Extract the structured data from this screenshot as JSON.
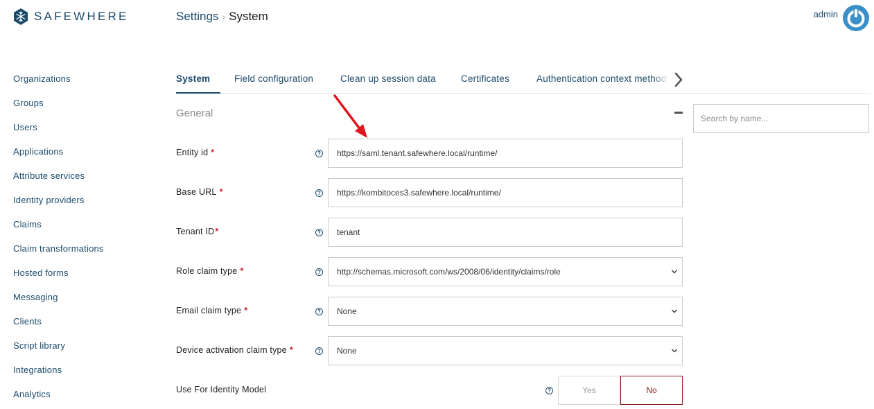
{
  "brand": {
    "name": "SAFEWHERE"
  },
  "header": {
    "breadcrumb_parent": "Settings",
    "breadcrumb_current": "System"
  },
  "user": {
    "name": "admin"
  },
  "sidebar": {
    "items": [
      {
        "label": "Organizations"
      },
      {
        "label": "Groups"
      },
      {
        "label": "Users"
      },
      {
        "label": "Applications"
      },
      {
        "label": "Attribute services"
      },
      {
        "label": "Identity providers"
      },
      {
        "label": "Claims"
      },
      {
        "label": "Claim transformations"
      },
      {
        "label": "Hosted forms"
      },
      {
        "label": "Messaging"
      },
      {
        "label": "Clients"
      },
      {
        "label": "Script library"
      },
      {
        "label": "Integrations"
      },
      {
        "label": "Analytics"
      }
    ]
  },
  "tabs": [
    {
      "label": "System",
      "active": true
    },
    {
      "label": "Field configuration"
    },
    {
      "label": "Clean up session data"
    },
    {
      "label": "Certificates"
    },
    {
      "label": "Authentication context methods"
    }
  ],
  "section": {
    "title": "General"
  },
  "search": {
    "placeholder": "Search by name..."
  },
  "form": {
    "entity_id": {
      "label": "Entity id",
      "value": "https://saml.tenant.safewhere.local/runtime/"
    },
    "base_url": {
      "label": "Base URL",
      "value": "https://kombitoces3.safewhere.local/runtime/"
    },
    "tenant_id": {
      "label": "Tenant ID",
      "value": "tenant"
    },
    "role_claim_type": {
      "label": "Role claim type",
      "value": "http://schemas.microsoft.com/ws/2008/06/identity/claims/role"
    },
    "email_claim_type": {
      "label": "Email claim type",
      "value": "None"
    },
    "device_activation_claim_type": {
      "label": "Device activation claim type",
      "value": "None"
    },
    "use_for_identity_model": {
      "label": "Use For Identity Model",
      "yes_label": "Yes",
      "no_label": "No",
      "selected": "No"
    }
  },
  "required_mark": "*",
  "help_mark": "?",
  "colors": {
    "primary": "#1b4a6b",
    "required": "#c0272d",
    "toggle_active": "#8b1a1a",
    "annotation_arrow": "#e0141e"
  },
  "icons": {
    "logo": "snowflake-icon",
    "user": "power-icon",
    "tab_next": "chevron-right-icon",
    "collapse": "minus-icon",
    "select": "chevron-down-icon"
  }
}
